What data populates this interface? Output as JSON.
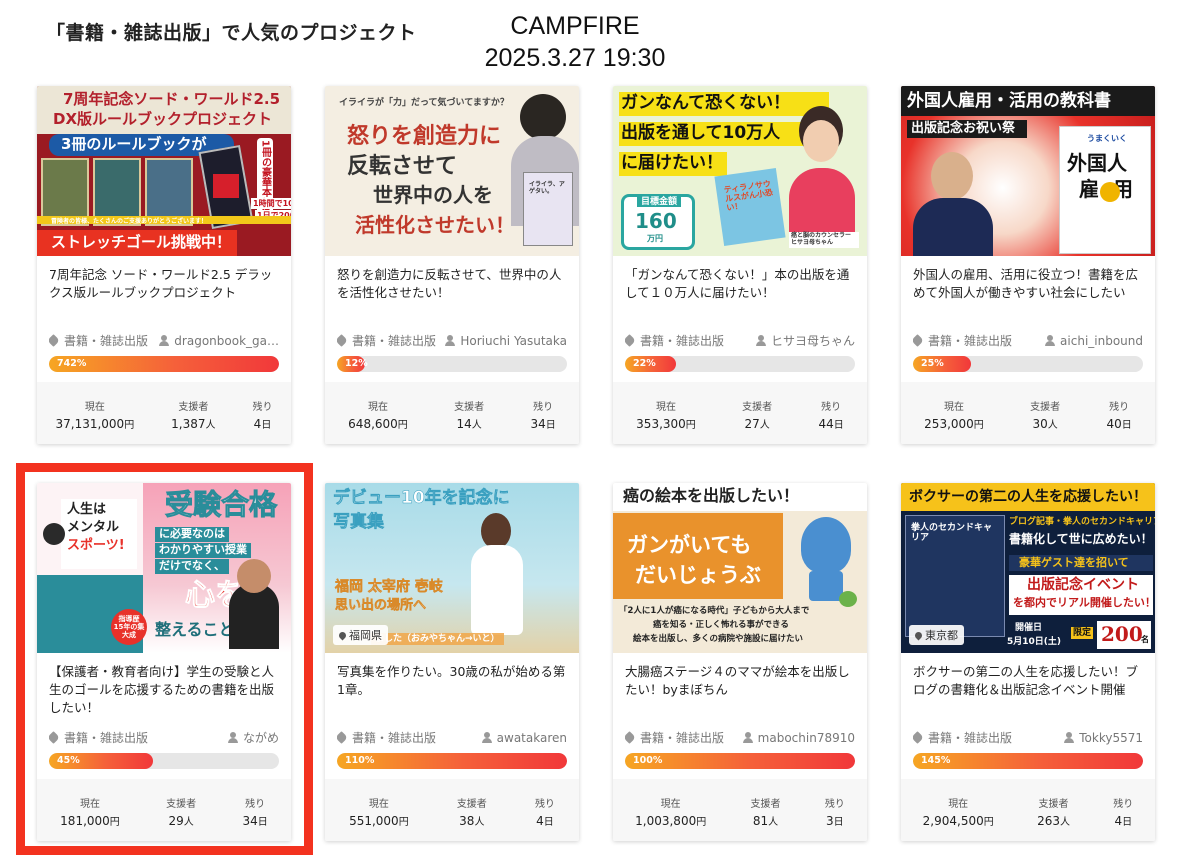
{
  "page": {
    "heading": "「書籍・雑誌出版」で人気のプロジェクト",
    "brand": "CAMPFIRE",
    "date": "2025.3.27 19:30"
  },
  "stat_labels": {
    "current": "現在",
    "supporters": "支援者",
    "remaining": "残り"
  },
  "colors": {
    "progress_start": "#f6a623",
    "progress_end": "#f1383a",
    "highlight": "#f3321f"
  },
  "projects": [
    {
      "thumb": {
        "line1": "7周年記念ソード・ワールド2.5",
        "line2": "DX版ルールブックプロジェクト",
        "line3": "3冊のルールブックが",
        "line4": "1冊の豪華本に!!",
        "line5": "ストレッチゴール挑戦中！",
        "line6": "1時間で100%達成！",
        "line7": "1日で200%突破！",
        "line8": "冒険者の皆様、たくさんのご支援ありがとうございます！"
      },
      "title": "7周年記念 ソード・ワールド2.5 デラックス版ルールブックプロジェクト",
      "category": "書籍・雑誌出版",
      "owner": "dragonbook_ga…",
      "percent_label": "742%",
      "percent": 742,
      "current": "37,131,000",
      "supporters": "1,387",
      "days_left": "4"
    },
    {
      "thumb": {
        "line1": "イライラが「力」だって気づいてますか？",
        "line2": "怒りを創造力に",
        "line3": "反転させて",
        "line4": "世界中の人を",
        "line5": "活性化させたい！",
        "line6": "イライラ、アゲタい。"
      },
      "title": "怒りを創造力に反転させて、世界中の人を活性化させたい！",
      "category": "書籍・雑誌出版",
      "owner": "Horiuchi Yasutaka",
      "percent_label": "12%",
      "percent": 12,
      "current": "648,600",
      "supporters": "14",
      "days_left": "34"
    },
    {
      "thumb": {
        "line1": "ガンなんて恐くない！",
        "line2": "出版を通して10万人",
        "line3": "に届けたい！",
        "line4": "目標金額",
        "line5": "160",
        "line6": "万円",
        "line7": "癌と脳のカウンセラー ヒサヨ母ちゃん",
        "line8": "ティラノサウルスがん小恐い！"
      },
      "title": "「ガンなんて恐くない！」本の出版を通して１０万人に届けたい！",
      "category": "書籍・雑誌出版",
      "owner": "ヒサヨ母ちゃん",
      "percent_label": "22%",
      "percent": 22,
      "current": "353,300",
      "supporters": "27",
      "days_left": "44"
    },
    {
      "thumb": {
        "line1": "外国人雇用・活用の教科書",
        "line2": "出版記念お祝い祭",
        "line3": "外国人",
        "line4": "雇用",
        "line5": "うまくいく"
      },
      "title": "外国人の雇用、活用に役立つ！書籍を広めて外国人が働きやすい社会にしたい",
      "category": "書籍・雑誌出版",
      "owner": "aichi_inbound",
      "percent_label": "25%",
      "percent": 25,
      "current": "253,000",
      "supporters": "30",
      "days_left": "40"
    },
    {
      "thumb": {
        "line1": "受験合格",
        "line2": "に必要なのは",
        "line3": "わかりやすい授業",
        "line4": "だけでなく、",
        "line5": "心を",
        "line6": "整えること！",
        "line7": "人生は",
        "line8": "メンタル",
        "line9": "スポーツ!",
        "line10": "指導歴 15年の集大成"
      },
      "title": "【保護者・教育者向け】学生の受験と人生のゴールを応援するための書籍を出版したい！",
      "category": "書籍・雑誌出版",
      "owner": "ながめ",
      "percent_label": "45%",
      "percent": 45,
      "current": "181,000",
      "supporters": "29",
      "days_left": "34"
    },
    {
      "thumb": {
        "line1": "デビュー10年を記念に",
        "line2": "写真集",
        "line3": "福岡 太宰府 壱岐",
        "line4": "思い出の場所へ",
        "line5": "ました（おみやちゃん→いと）",
        "location": "福岡県"
      },
      "title": "写真集を作りたい。30歳の私が始める第1章。",
      "category": "書籍・雑誌出版",
      "owner": "awatakaren",
      "percent_label": "110%",
      "percent": 110,
      "current": "551,000",
      "supporters": "38",
      "days_left": "4"
    },
    {
      "thumb": {
        "line1": "癌の絵本を出版したい！",
        "line2": "ガンがいても",
        "line3": "だいじょうぶ",
        "line4": "「2人に1人が癌になる時代」子どもから大人まで",
        "line5": "癌を知る・正しく怖れる事ができる",
        "line6": "絵本を出版し、多くの病院や施設に届けたい"
      },
      "title": "大腸癌ステージ４のママが絵本を出版したい！byまぼちん",
      "category": "書籍・雑誌出版",
      "owner": "mabochin78910",
      "percent_label": "100%",
      "percent": 100,
      "current": "1,003,800",
      "supporters": "81",
      "days_left": "3"
    },
    {
      "thumb": {
        "line1": "ボクサーの第二の人生を応援したい！",
        "line2": "ブログ記事・拳人のセカンドキャリア",
        "line3": "書籍化して世に広めたい！",
        "line4": "豪華ゲスト達を招いて",
        "line5": "出版記念イベント",
        "line6": "を都内でリアル開催したい！",
        "line7": "開催日",
        "line8": "5月10日(土)",
        "line9": "限定",
        "line10": "200",
        "line11": "名",
        "line12": "拳人のセカンドキャリア",
        "location": "東京都"
      },
      "title": "ボクサーの第二の人生を応援したい！ブログの書籍化＆出版記念イベント開催",
      "category": "書籍・雑誌出版",
      "owner": "Tokky5571",
      "percent_label": "145%",
      "percent": 145,
      "current": "2,904,500",
      "supporters": "263",
      "days_left": "4"
    }
  ]
}
